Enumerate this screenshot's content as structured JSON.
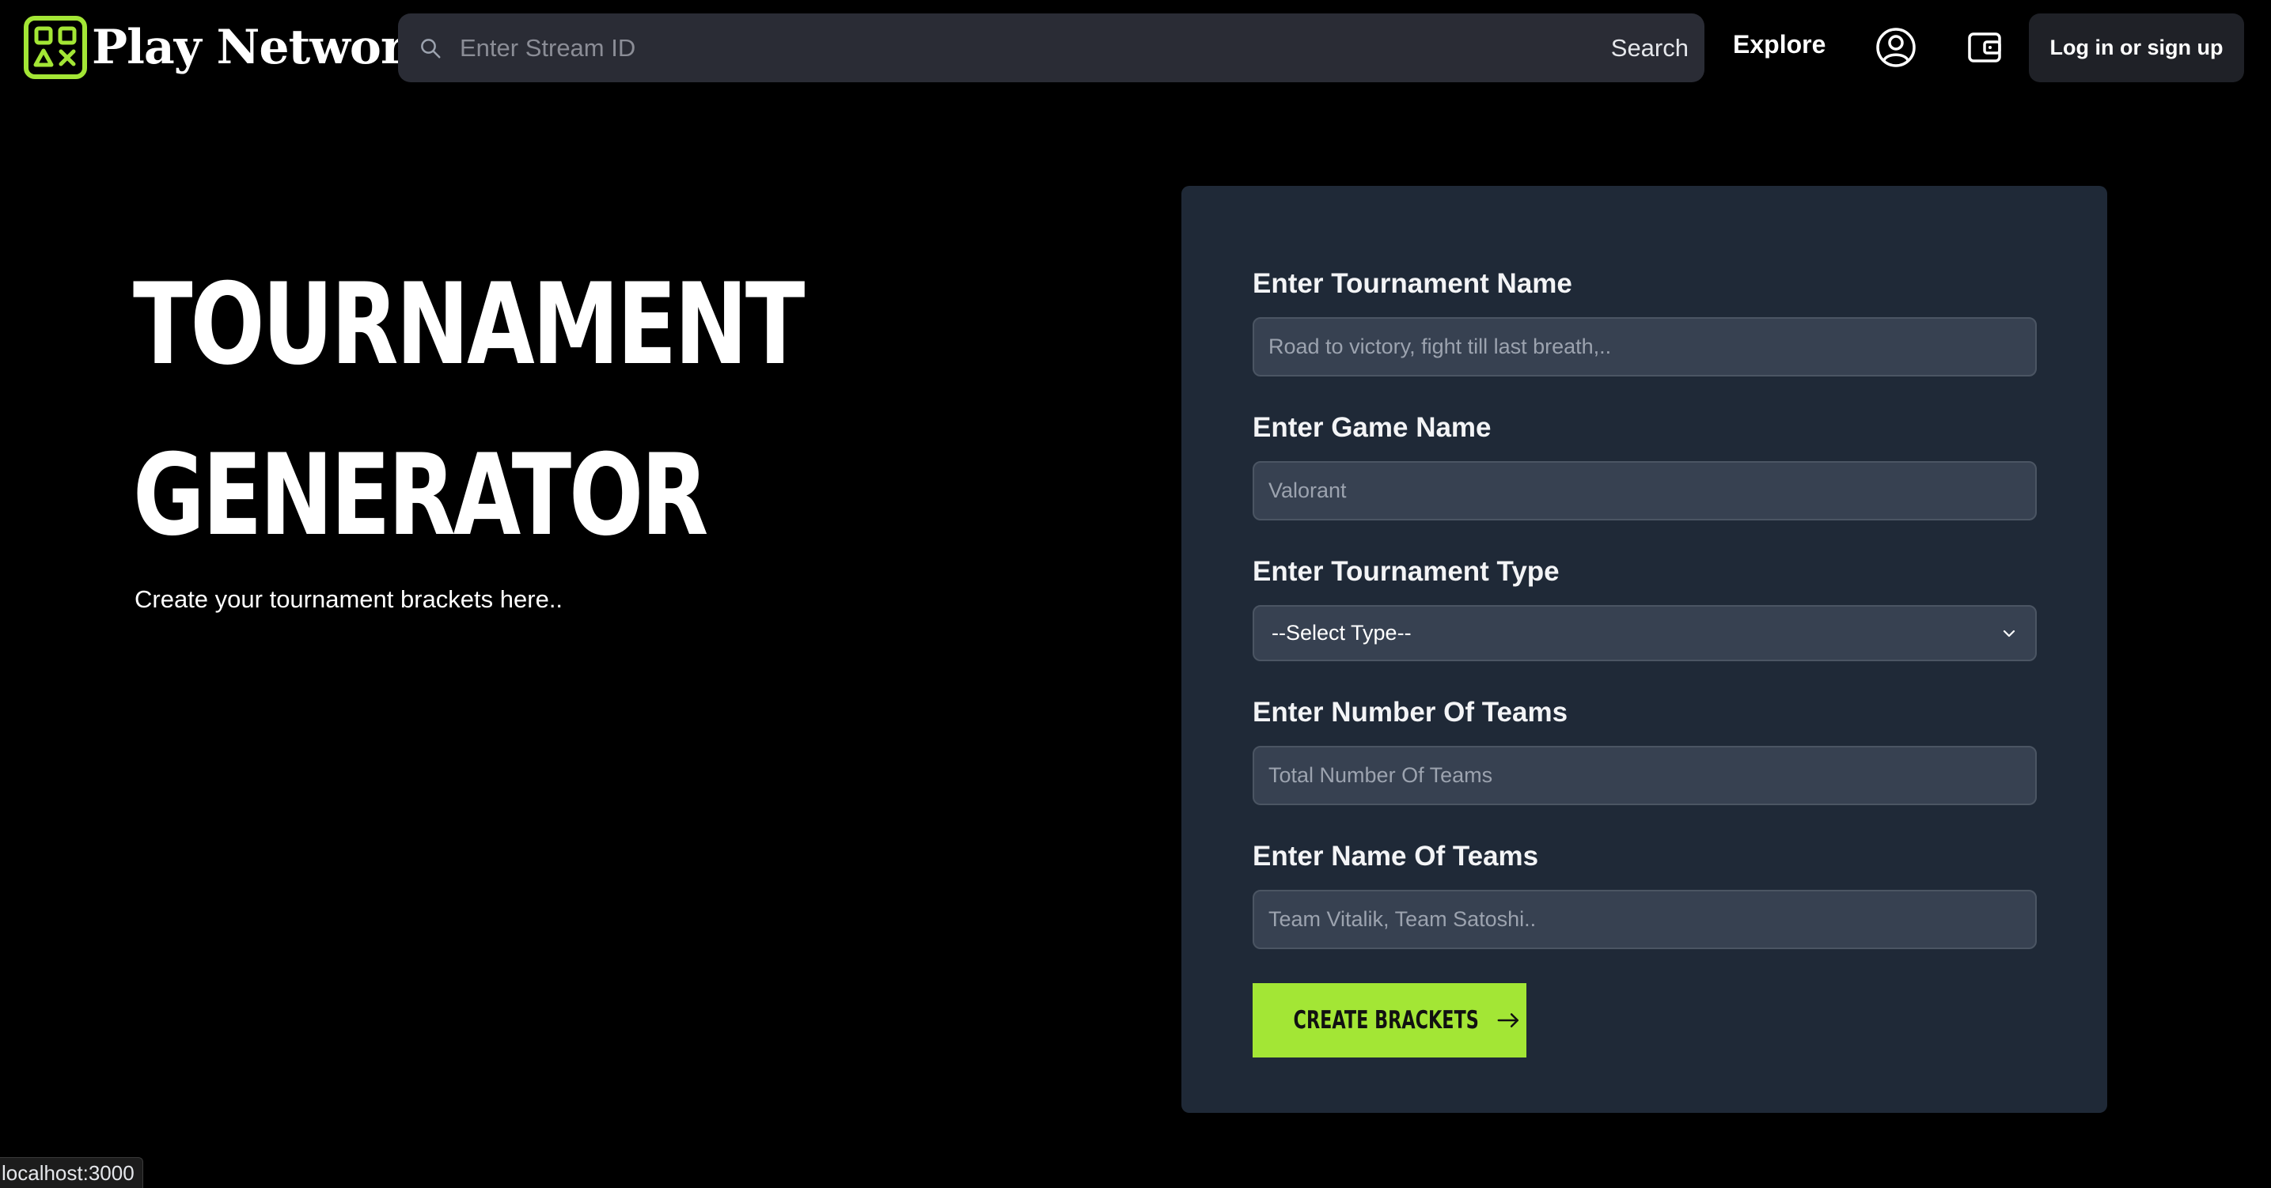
{
  "header": {
    "brand_name": "Play Network",
    "search": {
      "placeholder": "Enter Stream ID",
      "button_label": "Search"
    },
    "explore_label": "Explore",
    "login_label": "Log in or sign up",
    "icons": [
      "search-icon",
      "profile-icon",
      "wallet-icon"
    ]
  },
  "hero": {
    "title_line_1": "TOURNAMENT",
    "title_line_2": "GENERATOR",
    "subtitle": "Create your tournament brackets here.."
  },
  "form": {
    "tournament_name": {
      "label": "Enter Tournament Name",
      "placeholder": "Road to victory, fight till last breath,.."
    },
    "game_name": {
      "label": "Enter Game Name",
      "placeholder": "Valorant"
    },
    "tournament_type": {
      "label": "Enter Tournament Type",
      "selected": "--Select Type--"
    },
    "number_of_teams": {
      "label": "Enter Number Of Teams",
      "placeholder": "Total Number Of Teams"
    },
    "team_names": {
      "label": "Enter Name Of Teams",
      "placeholder": "Team Vitalik, Team Satoshi.."
    },
    "submit_label": "CREATE BRACKETS"
  },
  "status_bar": {
    "url": "localhost:3000"
  },
  "colors": {
    "background": "#000000",
    "accent": "#a3e635",
    "card": "#1f2937",
    "input": "#374151",
    "search_bar": "#2a2c35"
  }
}
